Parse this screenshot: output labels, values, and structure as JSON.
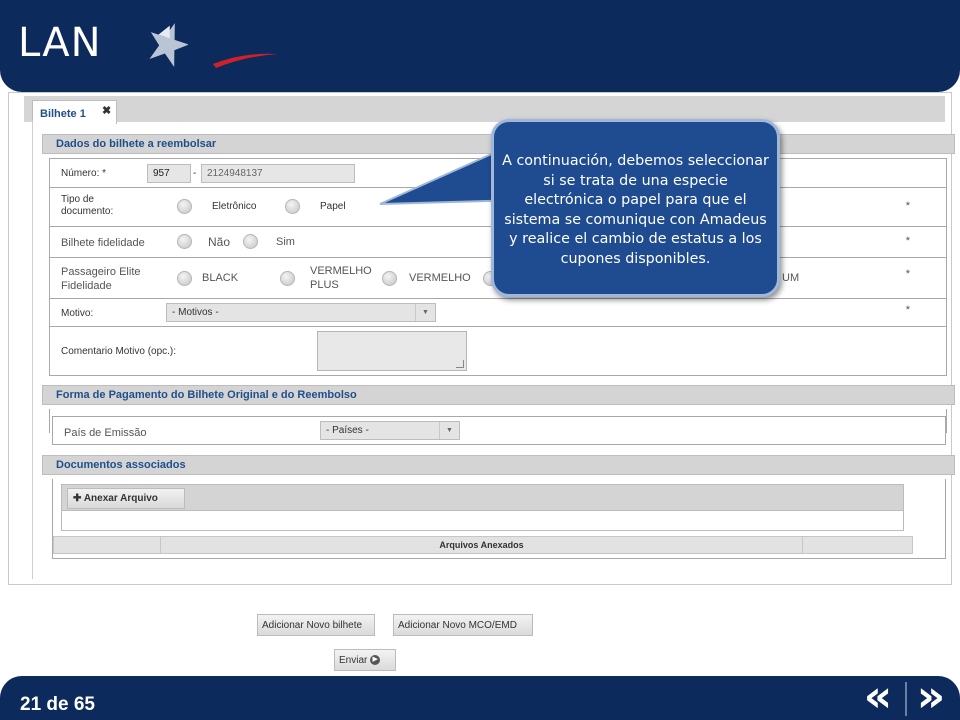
{
  "header": {
    "logo_text": "LAN"
  },
  "tab": {
    "label": "Bilhete 1",
    "close_glyph": "✖"
  },
  "section1": {
    "title": "Dados do bilhete a reembolsar",
    "numero": {
      "label": "Número: *",
      "prefix_value": "957",
      "separator": "-",
      "ticket_value": "2124948137"
    },
    "tipo_documento": {
      "label_line1": "Tipo de",
      "label_line2": "documento:",
      "options": [
        "Eletrônico",
        "Papel"
      ],
      "required": "*"
    },
    "bilhete_fidelidade": {
      "label": "Bilhete fidelidade",
      "options": [
        "Não",
        "Sim"
      ],
      "required": "*"
    },
    "passageiro_elite": {
      "label_line1": "Passageiro Elite",
      "label_line2": "Fidelidade",
      "options": [
        "BLACK",
        "VERMELHO PLUS",
        "VERMELHO"
      ],
      "options_line": {
        "vermelho_plus_1": "VERMELHO",
        "vermelho_plus_2": "PLUS"
      },
      "partial_option": "UM",
      "required": "*"
    },
    "motivo": {
      "label": "Motivo:",
      "select_value": "- Motivos -",
      "required": "*"
    },
    "comentario": {
      "label": "Comentario Motivo (opc.):"
    }
  },
  "section2": {
    "title": "Forma de Pagamento do Bilhete Original e do Reembolso",
    "pais": {
      "label": "País de Emissão",
      "select_value": "- Países -"
    }
  },
  "section3": {
    "title": "Documentos associados",
    "attach_button": "Anexar Arquivo",
    "attach_icon": "plus-icon",
    "table_header": "Arquivos Anexados"
  },
  "buttons": {
    "add_ticket": "Adicionar Novo bilhete",
    "add_mco": "Adicionar Novo MCO/EMD",
    "send": "Enviar"
  },
  "callout": {
    "text": "A continuación, debemos seleccionar si se trata de una especie electrónica o papel para que el sistema se comunique con Amadeus y realice el cambio de estatus a los cupones disponibles."
  },
  "footer": {
    "page_counter": "21 de 65",
    "prev_glyph": "«",
    "next_glyph": "»"
  },
  "colors": {
    "brand_navy": "#0c2a5b",
    "callout_blue": "#1f4c90",
    "section_text": "#1f4f8a",
    "logo_red": "#d0202a"
  }
}
